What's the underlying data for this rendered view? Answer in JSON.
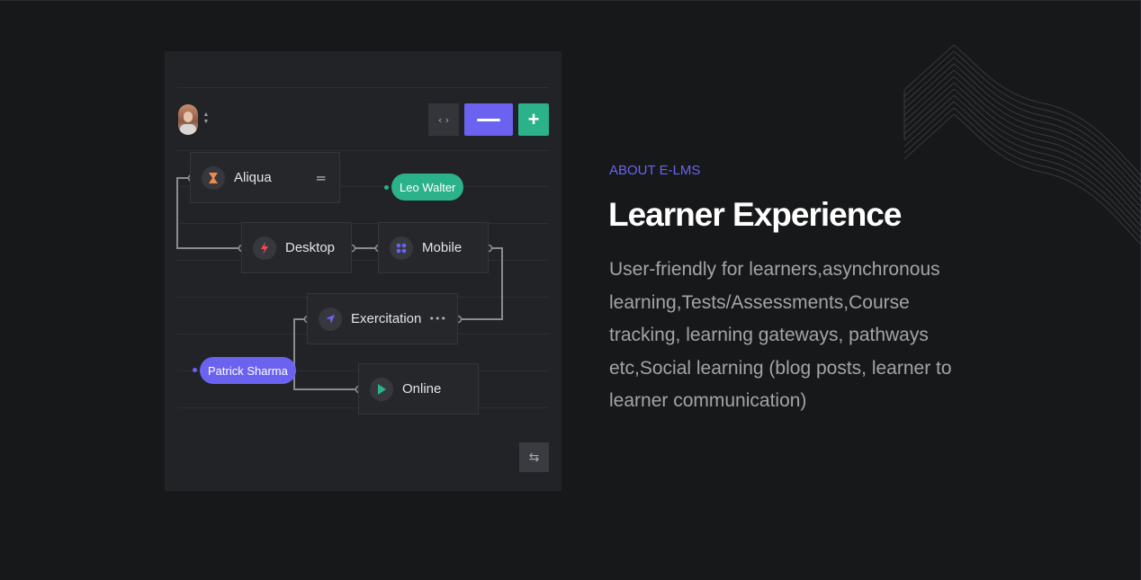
{
  "toolbar": {
    "code_icon": "code-icon",
    "minus_icon": "minus-icon",
    "plus_icon": "plus-icon",
    "avatar_icon": "user-avatar",
    "sort_icon": "sort-updown-icon"
  },
  "nodes": [
    {
      "label": "Aliqua",
      "icon": "hourglass-icon",
      "icon_color": "#f08a4b",
      "trail": "="
    },
    {
      "label": "Desktop",
      "icon": "bolt-icon",
      "icon_color": "#ef4a5a"
    },
    {
      "label": "Mobile",
      "icon": "grid-dots-icon",
      "icon_color": "#6b63f0"
    },
    {
      "label": "Exercitation",
      "icon": "navigation-arrow-icon",
      "icon_color": "#6b63f0",
      "trail": "•••"
    },
    {
      "label": "Online",
      "icon": "play-icon",
      "icon_color": "#2bb28a"
    }
  ],
  "tags": [
    {
      "label": "Leo Walter",
      "color": "#2bb28a"
    },
    {
      "label": "Patrick Sharma",
      "color": "#6b63f0"
    }
  ],
  "swap_icon": "swap-arrows-icon",
  "section": {
    "eyebrow": "ABOUT E-LMS",
    "title": "Learner Experience",
    "description": "User-friendly for learners,asynchronous learning,Tests/Assessments,Course tracking, learning gateways, pathways etc,Social learning (blog posts, learner to learner communication)"
  },
  "colors": {
    "background": "#17181a",
    "panel": "#222327",
    "accent_purple": "#6b63f0",
    "accent_green": "#2bb28a"
  }
}
